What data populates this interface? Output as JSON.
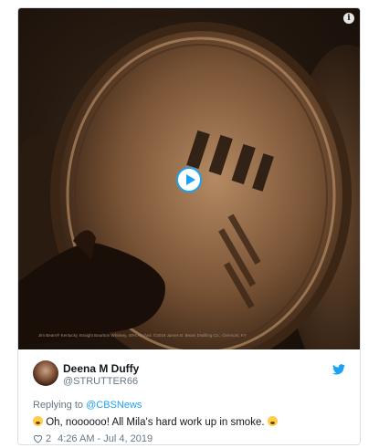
{
  "media": {
    "info_glyph": "i",
    "caption": "Jim Beam® Kentucky Straight Bourbon Whiskey, 40% Alc./Vol. ©2018 James B. Beam Distilling Co., Clermont, KY",
    "icons": [
      "info-icon",
      "play-icon"
    ]
  },
  "tweet": {
    "display_name": "Deena M Duffy",
    "handle": "@STRUTTER66",
    "replying_prefix": "Replying to ",
    "replying_to": "@CBSNews",
    "text": " Oh, noooooo! All Mila's hard work up in smoke. ",
    "like_count": "2",
    "timestamp": "4:26 AM - Jul 4, 2019",
    "accent_color": "#1da1f2",
    "icons": [
      "twitter-bird-icon",
      "heart-icon"
    ]
  }
}
